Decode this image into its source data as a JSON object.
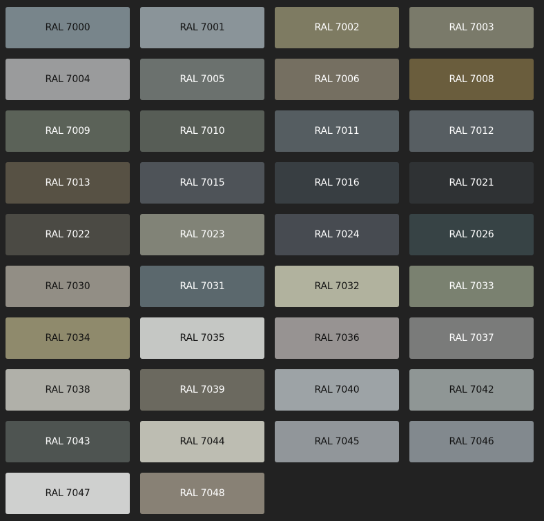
{
  "swatches": [
    {
      "label": "RAL 7000",
      "color": "#78858b",
      "text_color": "#111111"
    },
    {
      "label": "RAL 7001",
      "color": "#8a9499",
      "text_color": "#111111"
    },
    {
      "label": "RAL 7002",
      "color": "#7e7b62",
      "text_color": "#ffffff"
    },
    {
      "label": "RAL 7003",
      "color": "#7a7a6a",
      "text_color": "#ffffff"
    },
    {
      "label": "RAL 7004",
      "color": "#9a9b9c",
      "text_color": "#111111"
    },
    {
      "label": "RAL 7005",
      "color": "#6b716e",
      "text_color": "#ffffff"
    },
    {
      "label": "RAL 7006",
      "color": "#756f61",
      "text_color": "#ffffff"
    },
    {
      "label": "RAL 7008",
      "color": "#6a5d3d",
      "text_color": "#ffffff"
    },
    {
      "label": "RAL 7009",
      "color": "#5b6258",
      "text_color": "#ffffff"
    },
    {
      "label": "RAL 7010",
      "color": "#575d56",
      "text_color": "#ffffff"
    },
    {
      "label": "RAL 7011",
      "color": "#555d61",
      "text_color": "#ffffff"
    },
    {
      "label": "RAL 7012",
      "color": "#575e62",
      "text_color": "#ffffff"
    },
    {
      "label": "RAL 7013",
      "color": "#575144",
      "text_color": "#ffffff"
    },
    {
      "label": "RAL 7015",
      "color": "#4e5358",
      "text_color": "#ffffff"
    },
    {
      "label": "RAL 7016",
      "color": "#383e42",
      "text_color": "#ffffff"
    },
    {
      "label": "RAL 7021",
      "color": "#2f3234",
      "text_color": "#ffffff"
    },
    {
      "label": "RAL 7022",
      "color": "#4b4a44",
      "text_color": "#ffffff"
    },
    {
      "label": "RAL 7023",
      "color": "#818377",
      "text_color": "#ffffff"
    },
    {
      "label": "RAL 7024",
      "color": "#474b51",
      "text_color": "#ffffff"
    },
    {
      "label": "RAL 7026",
      "color": "#374345",
      "text_color": "#ffffff"
    },
    {
      "label": "RAL 7030",
      "color": "#928e85",
      "text_color": "#111111"
    },
    {
      "label": "RAL 7031",
      "color": "#5b686d",
      "text_color": "#ffffff"
    },
    {
      "label": "RAL 7032",
      "color": "#b1b29e",
      "text_color": "#111111"
    },
    {
      "label": "RAL 7033",
      "color": "#7a8170",
      "text_color": "#ffffff"
    },
    {
      "label": "RAL 7034",
      "color": "#8f8a6c",
      "text_color": "#111111"
    },
    {
      "label": "RAL 7035",
      "color": "#c5c7c4",
      "text_color": "#111111"
    },
    {
      "label": "RAL 7036",
      "color": "#979392",
      "text_color": "#111111"
    },
    {
      "label": "RAL 7037",
      "color": "#7a7b7a",
      "text_color": "#ffffff"
    },
    {
      "label": "RAL 7038",
      "color": "#b0b0a9",
      "text_color": "#111111"
    },
    {
      "label": "RAL 7039",
      "color": "#6b695f",
      "text_color": "#ffffff"
    },
    {
      "label": "RAL 7040",
      "color": "#9da3a6",
      "text_color": "#111111"
    },
    {
      "label": "RAL 7042",
      "color": "#8f9695",
      "text_color": "#111111"
    },
    {
      "label": "RAL 7043",
      "color": "#4e5451",
      "text_color": "#ffffff"
    },
    {
      "label": "RAL 7044",
      "color": "#bdbdb2",
      "text_color": "#111111"
    },
    {
      "label": "RAL 7045",
      "color": "#91969a",
      "text_color": "#111111"
    },
    {
      "label": "RAL 7046",
      "color": "#82898e",
      "text_color": "#111111"
    },
    {
      "label": "RAL 7047",
      "color": "#cfd0cf",
      "text_color": "#111111"
    },
    {
      "label": "RAL 7048",
      "color": "#888175",
      "text_color": "#ffffff"
    }
  ]
}
